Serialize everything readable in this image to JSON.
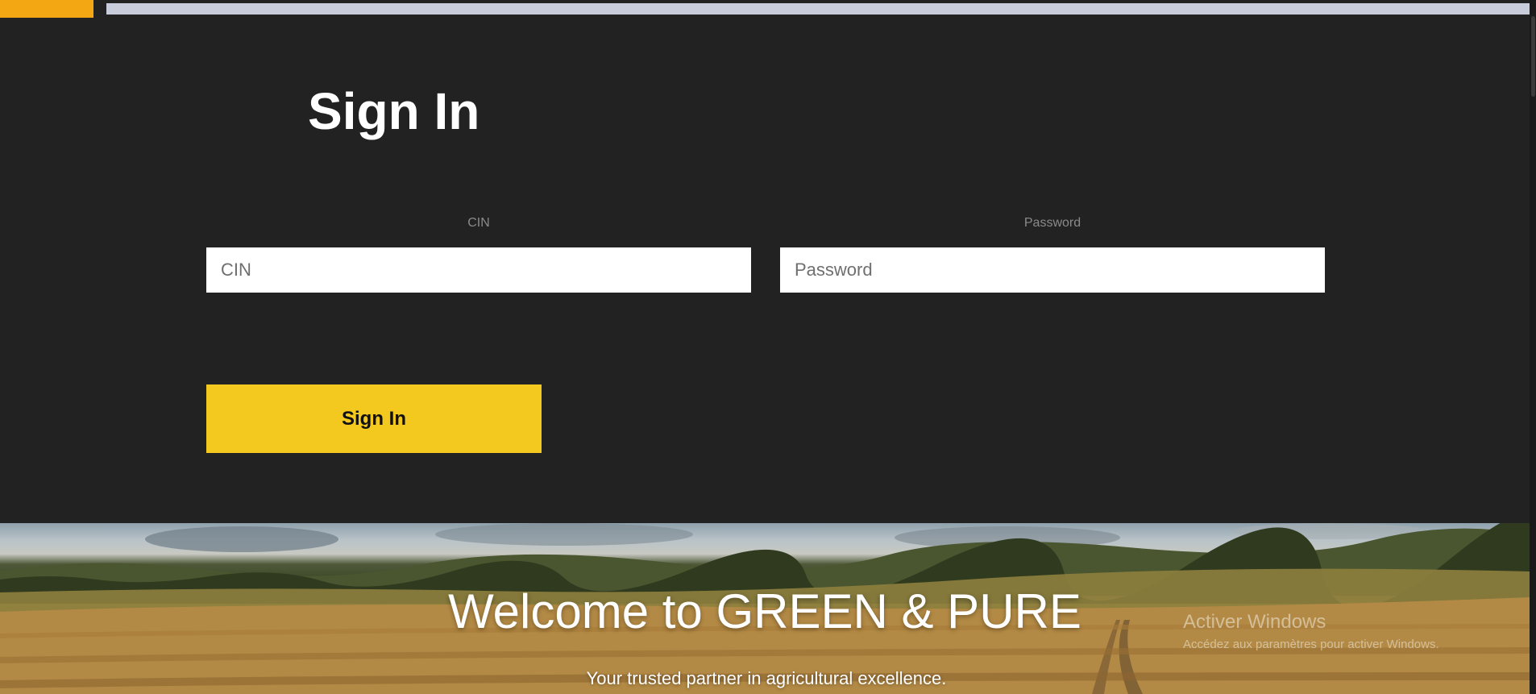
{
  "signin": {
    "title": "Sign In",
    "cin": {
      "label": "CIN",
      "placeholder": "CIN",
      "value": ""
    },
    "password": {
      "label": "Password",
      "placeholder": "Password",
      "value": ""
    },
    "button_label": "Sign In"
  },
  "hero": {
    "title": "Welcome to GREEN & PURE",
    "subtitle": "Your trusted partner in agricultural excellence."
  },
  "watermark": {
    "title": "Activer Windows",
    "subtitle": "Accédez aux paramètres pour activer Windows."
  },
  "colors": {
    "accent": "#f4c91f",
    "top_accent": "#f3a712",
    "background": "#222222",
    "label": "#8a8a8a"
  }
}
